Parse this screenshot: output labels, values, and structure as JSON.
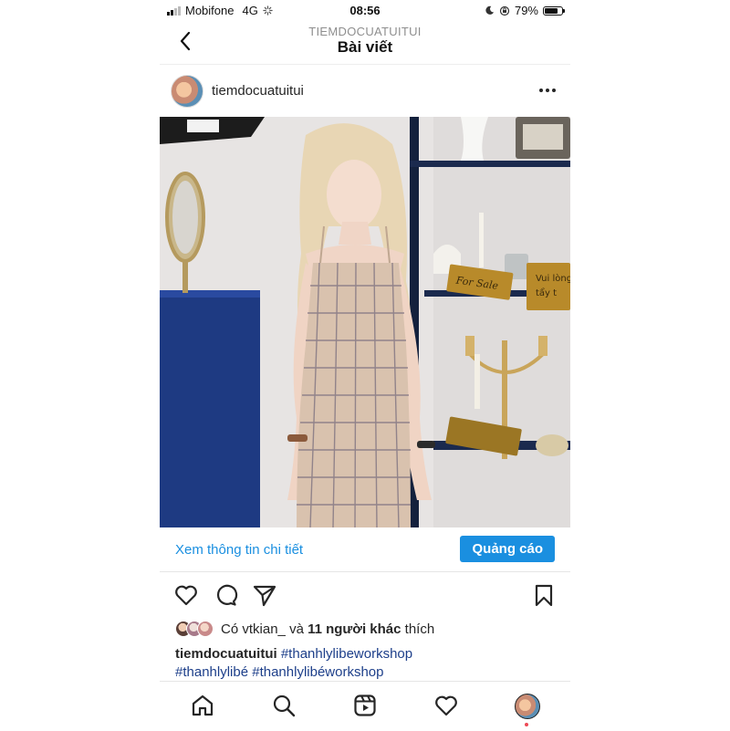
{
  "status_bar": {
    "carrier": "Mobifone",
    "network": "4G",
    "time": "08:56",
    "battery": "79%",
    "battery_level": 0.79
  },
  "nav": {
    "subtitle": "TIEMDOCUATUITUI",
    "title": "Bài viết"
  },
  "post": {
    "username": "tiemdocuatuitui",
    "image_signs": [
      "For Sale",
      "Vui lòng",
      "tẩy t"
    ],
    "cta_link": "Xem thông tin chi tiết",
    "cta_button": "Quảng cáo",
    "likes_prefix": "Có",
    "likes_user": "vtkian_",
    "likes_and": "và",
    "likes_others": "11 người khác",
    "likes_suffix": "thích",
    "caption_user": "tiemdocuatuitui",
    "caption_tags": [
      "#thanhlylibeworkshop",
      "#thanhlylibé",
      "#thanhlylibéworkshop"
    ]
  },
  "colors": {
    "accent": "#1a8fe0",
    "hashtag": "#1d3f8a",
    "notification_dot": "#ed4956"
  },
  "icons": [
    "signal-icon",
    "loading-icon",
    "moon-icon",
    "orientation-lock-icon",
    "battery-icon",
    "back-chevron-icon",
    "more-dots-icon",
    "heart-icon",
    "comment-icon",
    "share-icon",
    "bookmark-icon",
    "home-icon",
    "search-icon",
    "reels-icon",
    "activity-heart-icon",
    "profile-avatar-icon"
  ]
}
